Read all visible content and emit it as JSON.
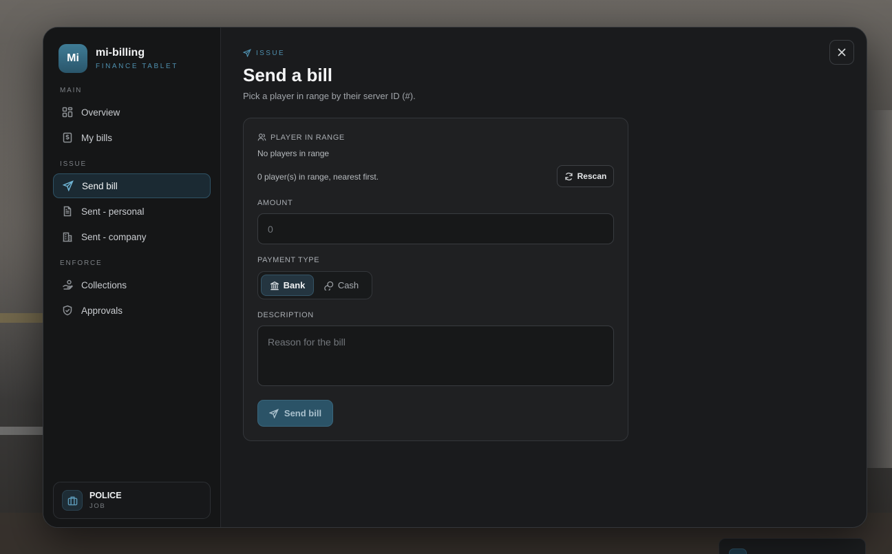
{
  "app": {
    "logo": "Mi",
    "title": "mi-billing",
    "subtitle": "FINANCE TABLET"
  },
  "sidebar": {
    "sections": [
      "MAIN",
      "ISSUE",
      "ENFORCE"
    ],
    "items": [
      {
        "label": "Overview",
        "icon": "grid-icon"
      },
      {
        "label": "My bills",
        "icon": "receipt-icon"
      },
      {
        "label": "Send bill",
        "icon": "send-icon",
        "active": true
      },
      {
        "label": "Sent - personal",
        "icon": "document-icon"
      },
      {
        "label": "Sent - company",
        "icon": "building-icon"
      },
      {
        "label": "Collections",
        "icon": "hand-coins-icon"
      },
      {
        "label": "Approvals",
        "icon": "shield-check-icon"
      }
    ]
  },
  "job": {
    "name": "POLICE",
    "label": "JOB",
    "icon": "briefcase-icon"
  },
  "header": {
    "eyebrow": "ISSUE",
    "title": "Send a bill",
    "subtitle": "Pick a player in range by their server ID (#)."
  },
  "form": {
    "player": {
      "label": "PLAYER IN RANGE",
      "status": "No players in range",
      "count_text": "0 player(s) in range, nearest first.",
      "rescan_label": "Rescan"
    },
    "amount": {
      "label": "AMOUNT",
      "placeholder": "0"
    },
    "payment": {
      "label": "PAYMENT TYPE",
      "options": [
        {
          "label": "Bank",
          "icon": "bank-icon",
          "selected": true
        },
        {
          "label": "Cash",
          "icon": "coins-icon",
          "selected": false
        }
      ]
    },
    "description": {
      "label": "DESCRIPTION",
      "placeholder": "Reason for the bill"
    },
    "submit_label": "Send bill"
  },
  "colors": {
    "accent": "#4e8fae",
    "panel": "#1a1b1d",
    "active_nav": "#1b2a33"
  }
}
